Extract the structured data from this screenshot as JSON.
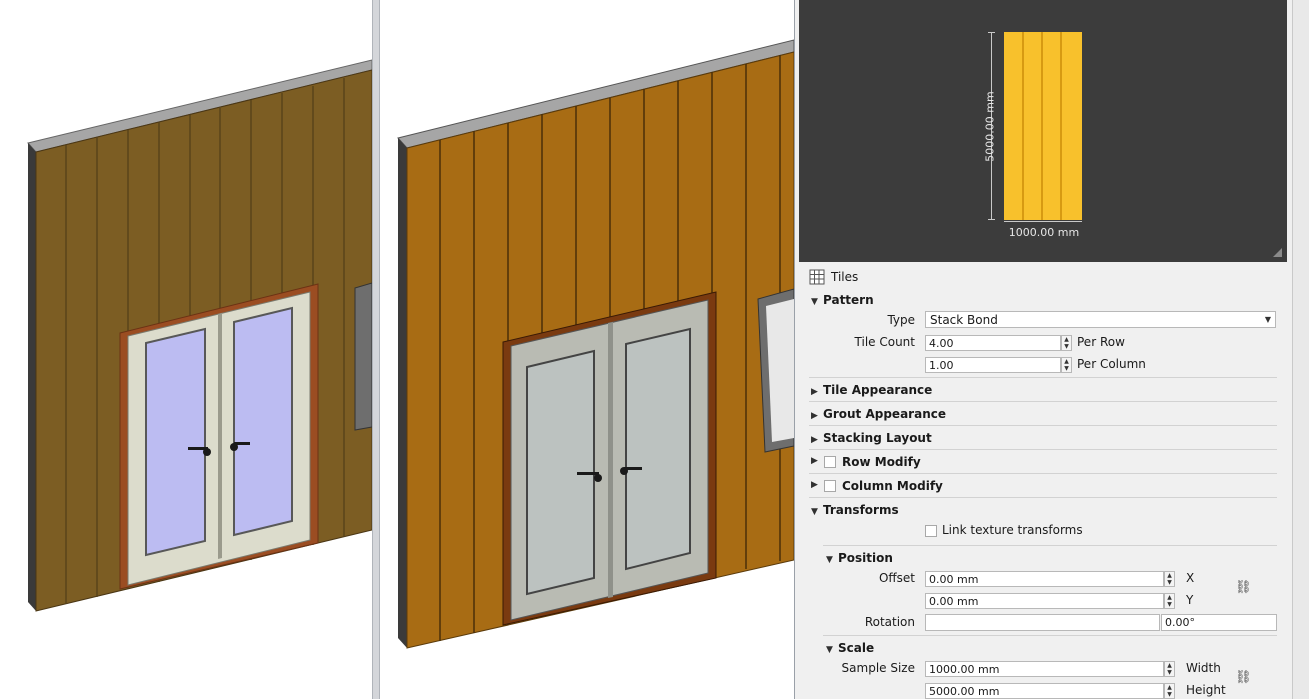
{
  "colors": {
    "wall_left": "#7c5d23",
    "wall_right": "#a86c14",
    "tile_swatch": "#f8c12c",
    "preview_bg": "#3c3c3c"
  },
  "preview": {
    "height_label": "5000.00 mm",
    "width_label": "1000.00 mm"
  },
  "panel": {
    "title": "Tiles",
    "pattern": {
      "header": "Pattern",
      "type_label": "Type",
      "type_value": "Stack Bond",
      "tile_count_label": "Tile Count",
      "per_row_value": "4.00",
      "per_row_label": "Per Row",
      "per_column_value": "1.00",
      "per_column_label": "Per Column"
    },
    "sections": {
      "tile_appearance": "Tile Appearance",
      "grout_appearance": "Grout Appearance",
      "stacking_layout": "Stacking Layout",
      "row_modify": "Row Modify",
      "column_modify": "Column Modify"
    },
    "transforms": {
      "header": "Transforms",
      "link_label": "Link texture transforms",
      "position": {
        "header": "Position",
        "offset_label": "Offset",
        "offset_x": "0.00 mm",
        "x_label": "X",
        "offset_y": "0.00 mm",
        "y_label": "Y",
        "rotation_label": "Rotation",
        "rotation_value": "",
        "rotation_angle": "0.00°"
      },
      "scale": {
        "header": "Scale",
        "sample_size_label": "Sample Size",
        "width_value": "1000.00 mm",
        "width_label": "Width",
        "height_value": "5000.00 mm",
        "height_label": "Height"
      }
    }
  }
}
